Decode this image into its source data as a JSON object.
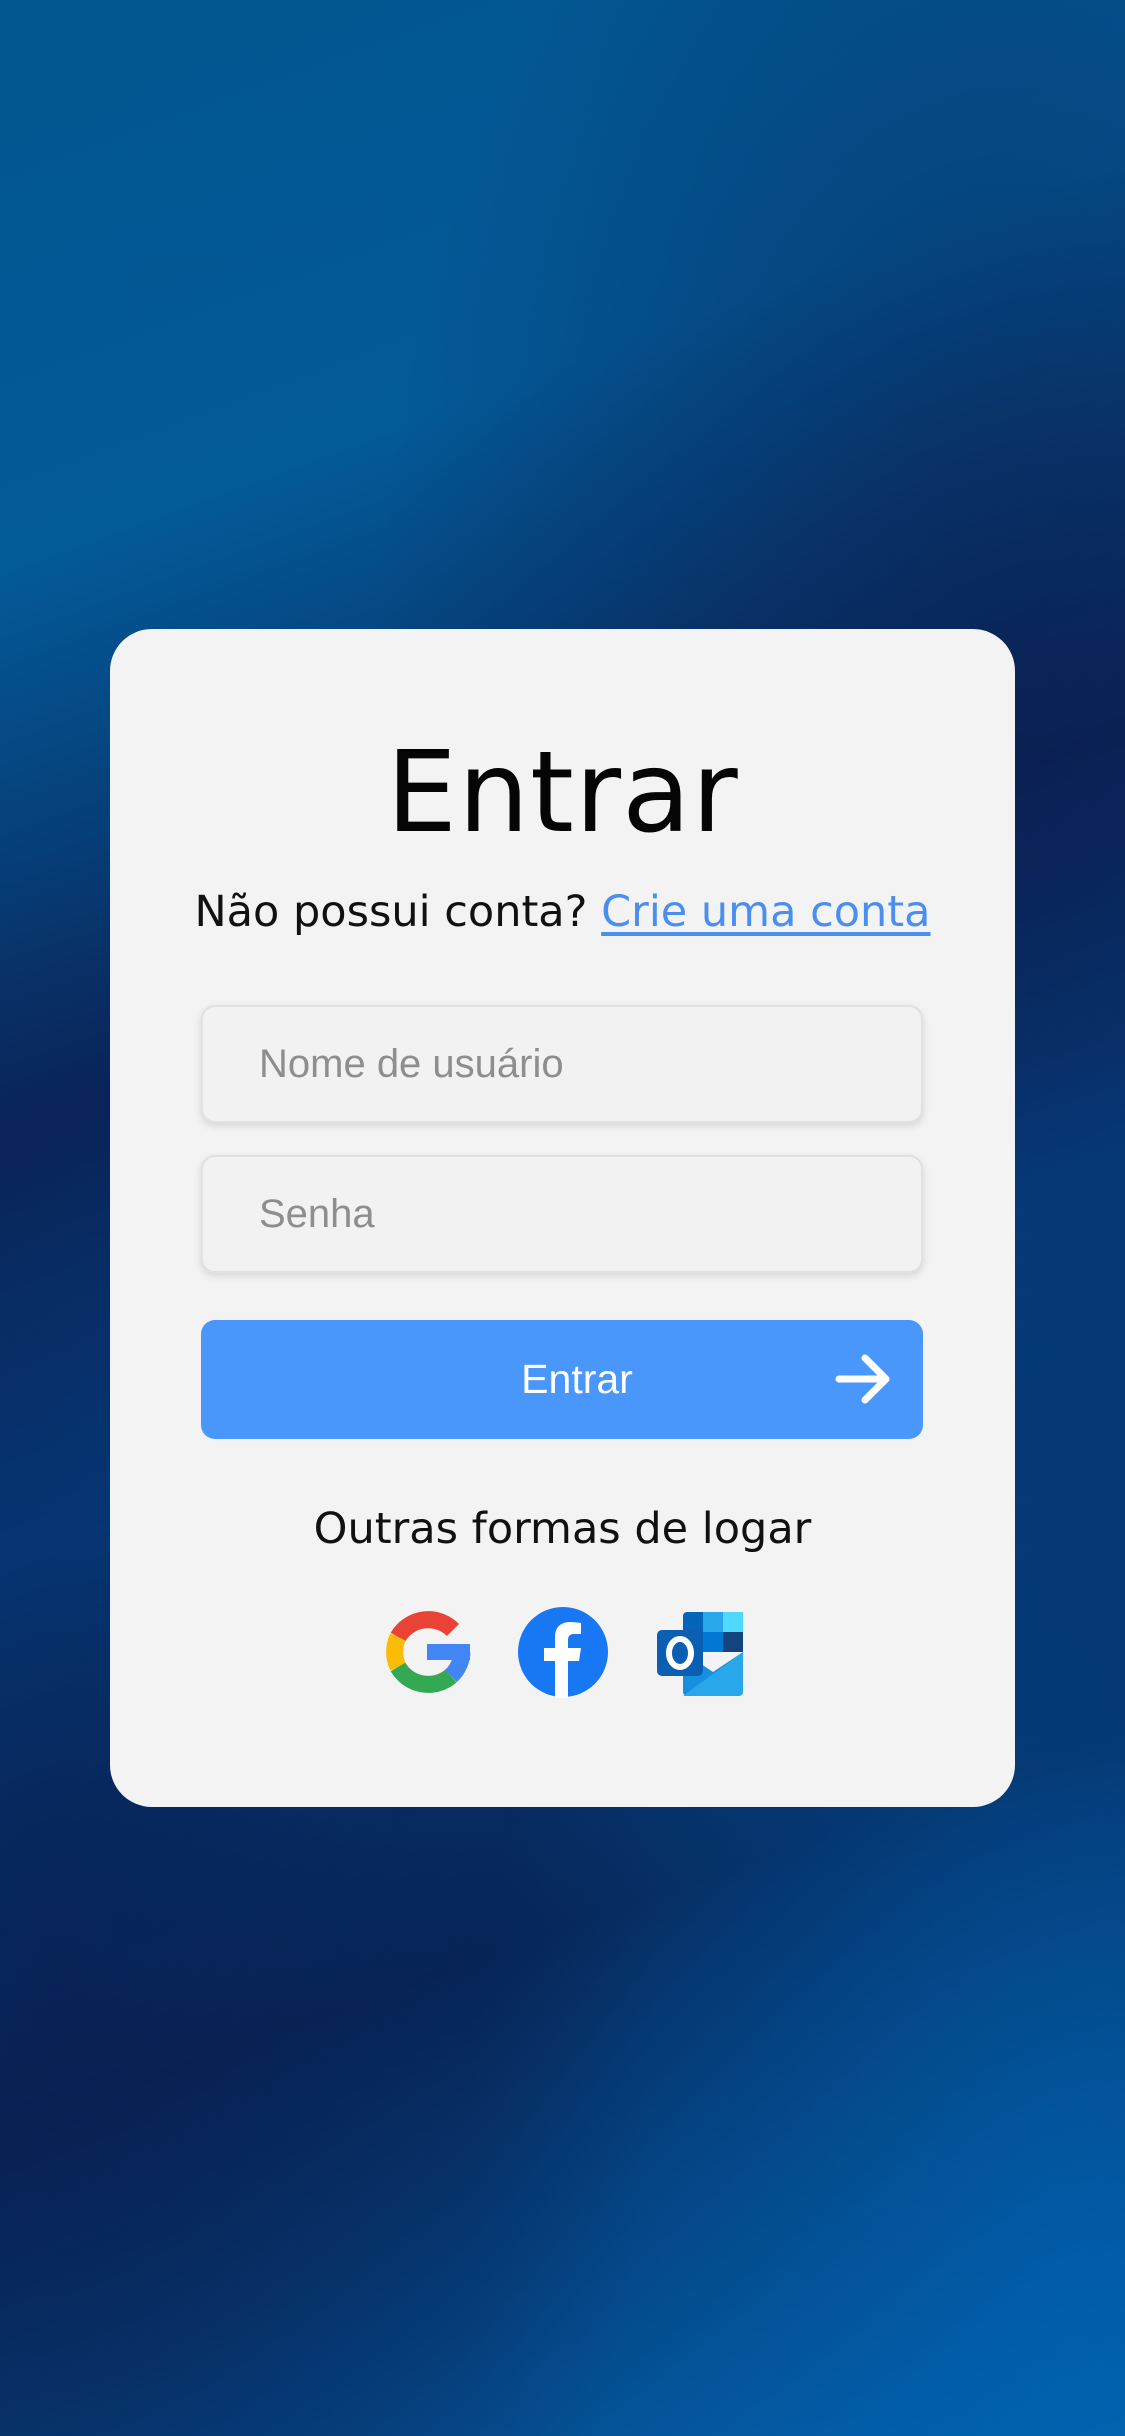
{
  "login": {
    "title": "Entrar",
    "no_account_text": "Não possui conta?",
    "create_account_link": "Crie uma conta",
    "username_placeholder": "Nome de usuário",
    "password_placeholder": "Senha",
    "submit_label": "Entrar",
    "other_methods_label": "Outras formas de logar",
    "social_providers": [
      "google-icon",
      "facebook-icon",
      "outlook-icon"
    ]
  },
  "colors": {
    "accent": "#4a97fb",
    "link": "#4a8ff0",
    "card_background": "#f3f3f3"
  }
}
